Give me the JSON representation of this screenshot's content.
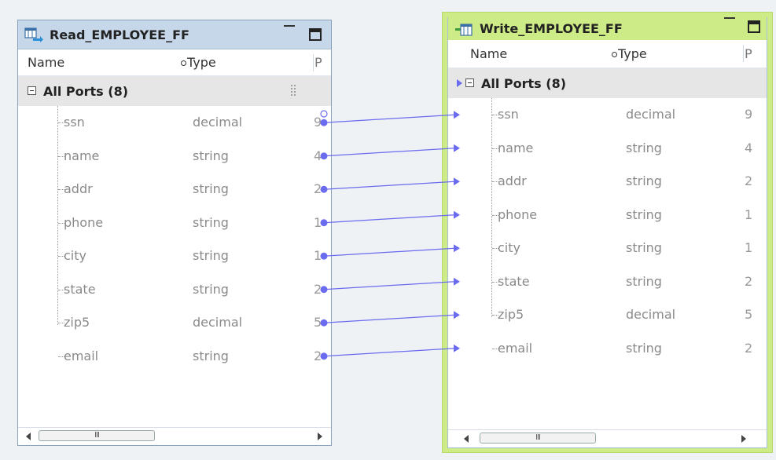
{
  "source": {
    "title": "Read_EMPLOYEE_FF",
    "icon": "read-flatfile-icon",
    "columns": {
      "name": "Name",
      "type": "Type",
      "precision": "P"
    },
    "group_label": "All Ports (8)",
    "ports": [
      {
        "name": "ssn",
        "type": "decimal",
        "precision": "9"
      },
      {
        "name": "name",
        "type": "string",
        "precision": "4"
      },
      {
        "name": "addr",
        "type": "string",
        "precision": "2"
      },
      {
        "name": "phone",
        "type": "string",
        "precision": "1"
      },
      {
        "name": "city",
        "type": "string",
        "precision": "1"
      },
      {
        "name": "state",
        "type": "string",
        "precision": "2"
      },
      {
        "name": "zip5",
        "type": "decimal",
        "precision": "5"
      },
      {
        "name": "email",
        "type": "string",
        "precision": "2"
      }
    ],
    "scrollbar_thumb": "III"
  },
  "target": {
    "title": "Write_EMPLOYEE_FF",
    "icon": "write-flatfile-icon",
    "columns": {
      "name": "Name",
      "type": "Type",
      "precision": "P"
    },
    "group_label": "All Ports (8)",
    "ports": [
      {
        "name": "ssn",
        "type": "decimal",
        "precision": "9"
      },
      {
        "name": "name",
        "type": "string",
        "precision": "4"
      },
      {
        "name": "addr",
        "type": "string",
        "precision": "2"
      },
      {
        "name": "phone",
        "type": "string",
        "precision": "1"
      },
      {
        "name": "city",
        "type": "string",
        "precision": "1"
      },
      {
        "name": "state",
        "type": "string",
        "precision": "2"
      },
      {
        "name": "zip5",
        "type": "decimal",
        "precision": "5"
      },
      {
        "name": "email",
        "type": "string",
        "precision": "2"
      }
    ],
    "scrollbar_thumb": "III"
  },
  "links": [
    {
      "from": "ssn",
      "to": "ssn"
    },
    {
      "from": "name",
      "to": "name"
    },
    {
      "from": "addr",
      "to": "addr"
    },
    {
      "from": "phone",
      "to": "phone"
    },
    {
      "from": "city",
      "to": "city"
    },
    {
      "from": "state",
      "to": "state"
    },
    {
      "from": "zip5",
      "to": "zip5"
    },
    {
      "from": "email",
      "to": "email"
    }
  ],
  "colors": {
    "link": "#6b6bf0",
    "source_title_bg": "#c5d7e8",
    "target_title_bg": "#cdeb86",
    "canvas_bg": "#eef2f5"
  }
}
